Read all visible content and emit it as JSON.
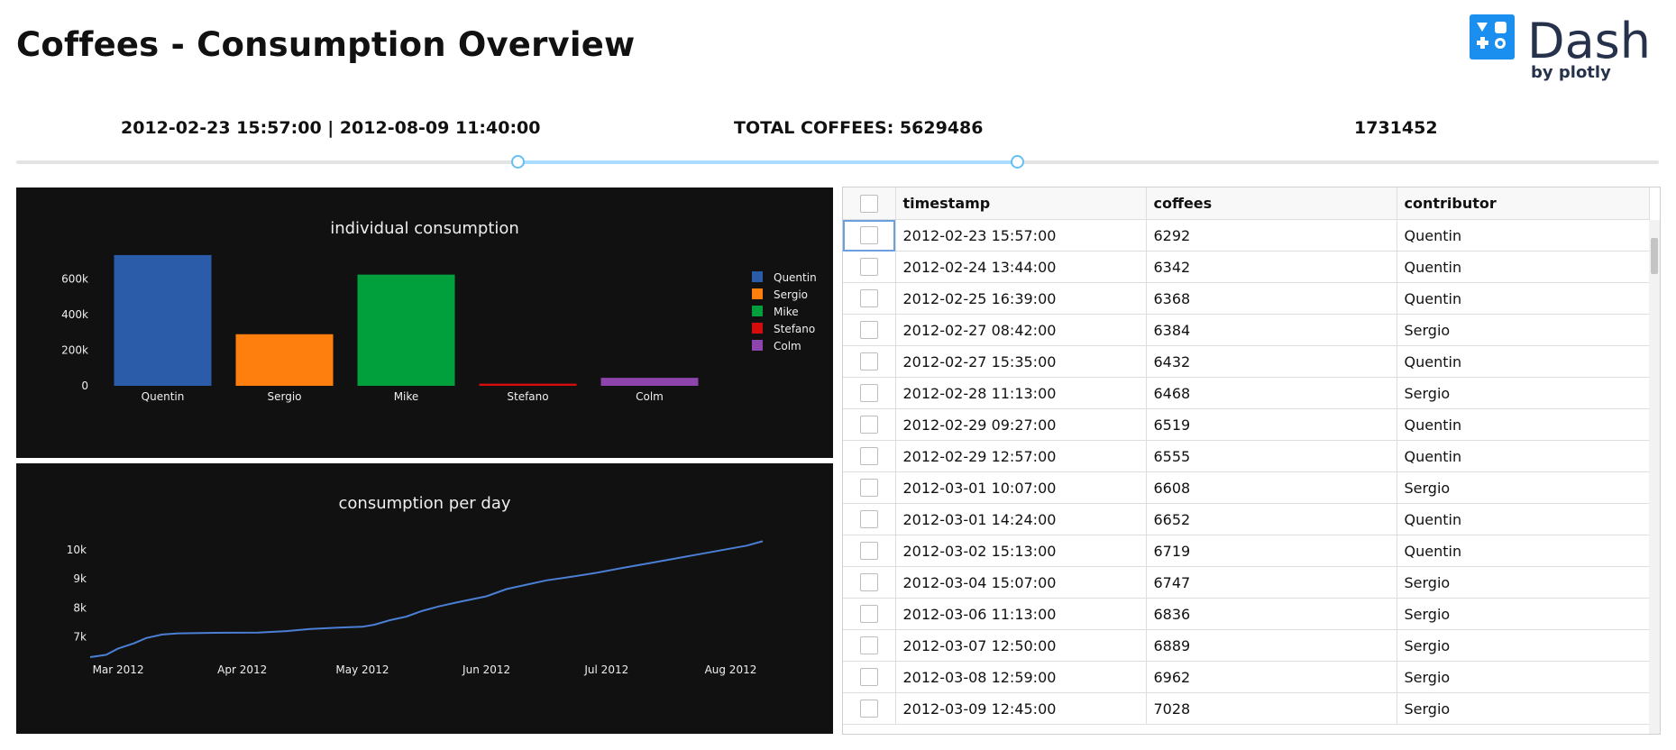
{
  "header": {
    "title": "Coffees - Consumption Overview",
    "logo_word": "Dash",
    "logo_by": "by plotly"
  },
  "stats": {
    "range": "2012-02-23 15:57:00 | 2012-08-09 11:40:00",
    "total": "TOTAL COFFEES: 5629486",
    "count": "1731452"
  },
  "slider": {
    "start_fraction": 0.305,
    "end_fraction": 0.609
  },
  "colors": {
    "bg_dark": "#111111",
    "slider_track": "#aadcff",
    "handle": "#66bff4"
  },
  "charts": {
    "individual": {
      "type": "bar",
      "title": "individual consumption",
      "categories": [
        "Quentin",
        "Sergio",
        "Mike",
        "Stefano",
        "Colm"
      ],
      "values": [
        735000,
        290000,
        625000,
        12000,
        45000
      ],
      "colors": [
        "#2a5ca9",
        "#ff7f0e",
        "#02a03c",
        "#d50c0c",
        "#8e44ad"
      ],
      "y_ticks": [
        "0",
        "200k",
        "400k",
        "600k"
      ],
      "y_tick_values": [
        0,
        200000,
        400000,
        600000
      ],
      "ylim": [
        0,
        760000
      ],
      "legend": [
        "Quentin",
        "Sergio",
        "Mike",
        "Stefano",
        "Colm"
      ]
    },
    "per_day": {
      "type": "line",
      "title": "consumption per day",
      "x_ticks": [
        "Mar 2012",
        "Apr 2012",
        "May 2012",
        "Jun 2012",
        "Jul 2012",
        "Aug 2012"
      ],
      "y_ticks": [
        "7k",
        "8k",
        "9k",
        "10k"
      ],
      "y_tick_values": [
        7000,
        8000,
        9000,
        10000
      ],
      "ylim": [
        6300,
        10500
      ],
      "xlim": [
        "2012-02-23",
        "2012-08-09"
      ],
      "x_tick_days": [
        "2012-03-01",
        "2012-04-01",
        "2012-05-01",
        "2012-06-01",
        "2012-07-01",
        "2012-08-01"
      ],
      "line_color": "#4a7fd4",
      "points": [
        [
          "2012-02-23",
          6300
        ],
        [
          "2012-02-27",
          6380
        ],
        [
          "2012-03-01",
          6600
        ],
        [
          "2012-03-05",
          6780
        ],
        [
          "2012-03-08",
          6960
        ],
        [
          "2012-03-12",
          7080
        ],
        [
          "2012-03-16",
          7120
        ],
        [
          "2012-03-25",
          7140
        ],
        [
          "2012-04-05",
          7150
        ],
        [
          "2012-04-12",
          7200
        ],
        [
          "2012-04-18",
          7270
        ],
        [
          "2012-04-25",
          7320
        ],
        [
          "2012-05-01",
          7350
        ],
        [
          "2012-05-04",
          7420
        ],
        [
          "2012-05-08",
          7580
        ],
        [
          "2012-05-12",
          7700
        ],
        [
          "2012-05-16",
          7900
        ],
        [
          "2012-05-20",
          8050
        ],
        [
          "2012-05-25",
          8200
        ],
        [
          "2012-06-01",
          8400
        ],
        [
          "2012-06-06",
          8650
        ],
        [
          "2012-06-11",
          8800
        ],
        [
          "2012-06-16",
          8950
        ],
        [
          "2012-06-21",
          9050
        ],
        [
          "2012-06-28",
          9200
        ],
        [
          "2012-07-05",
          9380
        ],
        [
          "2012-07-12",
          9550
        ],
        [
          "2012-07-20",
          9750
        ],
        [
          "2012-07-28",
          9950
        ],
        [
          "2012-08-05",
          10150
        ],
        [
          "2012-08-09",
          10300
        ]
      ]
    }
  },
  "table": {
    "headers": [
      "timestamp",
      "coffees",
      "contributor"
    ],
    "rows": [
      [
        "2012-02-23 15:57:00",
        "6292",
        "Quentin"
      ],
      [
        "2012-02-24 13:44:00",
        "6342",
        "Quentin"
      ],
      [
        "2012-02-25 16:39:00",
        "6368",
        "Quentin"
      ],
      [
        "2012-02-27 08:42:00",
        "6384",
        "Sergio"
      ],
      [
        "2012-02-27 15:35:00",
        "6432",
        "Quentin"
      ],
      [
        "2012-02-28 11:13:00",
        "6468",
        "Sergio"
      ],
      [
        "2012-02-29 09:27:00",
        "6519",
        "Quentin"
      ],
      [
        "2012-02-29 12:57:00",
        "6555",
        "Quentin"
      ],
      [
        "2012-03-01 10:07:00",
        "6608",
        "Sergio"
      ],
      [
        "2012-03-01 14:24:00",
        "6652",
        "Quentin"
      ],
      [
        "2012-03-02 15:13:00",
        "6719",
        "Quentin"
      ],
      [
        "2012-03-04 15:07:00",
        "6747",
        "Sergio"
      ],
      [
        "2012-03-06 11:13:00",
        "6836",
        "Sergio"
      ],
      [
        "2012-03-07 12:50:00",
        "6889",
        "Sergio"
      ],
      [
        "2012-03-08 12:59:00",
        "6962",
        "Sergio"
      ],
      [
        "2012-03-09 12:45:00",
        "7028",
        "Sergio"
      ]
    ]
  }
}
